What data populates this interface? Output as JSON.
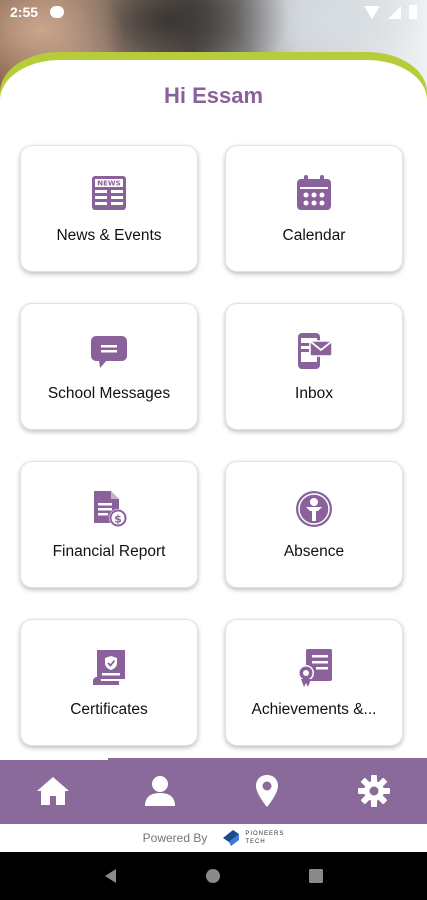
{
  "status": {
    "time": "2:55"
  },
  "greeting": "Hi Essam",
  "tiles": [
    {
      "label": "News & Events",
      "icon": "newspaper-icon"
    },
    {
      "label": "Calendar",
      "icon": "calendar-icon"
    },
    {
      "label": "School Messages",
      "icon": "chat-bubble-icon"
    },
    {
      "label": "Inbox",
      "icon": "phone-mail-icon"
    },
    {
      "label": "Financial Report",
      "icon": "document-dollar-icon"
    },
    {
      "label": "Absence",
      "icon": "person-circle-icon"
    },
    {
      "label": "Certificates",
      "icon": "certificate-scroll-icon"
    },
    {
      "label": "Achievements &...",
      "icon": "award-document-icon"
    }
  ],
  "bottom_nav": [
    "home-icon",
    "profile-icon",
    "location-icon",
    "settings-icon"
  ],
  "footer": {
    "powered_by": "Powered By",
    "brand_line1": "PIONEERS",
    "brand_line2": "TECH"
  },
  "colors": {
    "primary": "#8a619a",
    "nav": "#8a6a9a",
    "accent": "#b6cc3a"
  }
}
